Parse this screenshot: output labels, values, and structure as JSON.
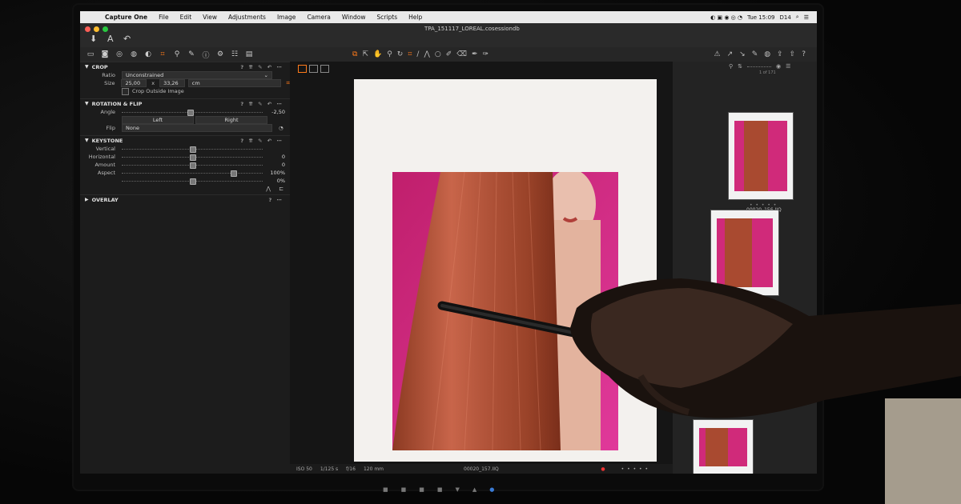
{
  "menubar": {
    "app": "Capture One",
    "items": [
      "File",
      "Edit",
      "View",
      "Adjustments",
      "Image",
      "Camera",
      "Window",
      "Scripts",
      "Help"
    ],
    "clock": "Tue 15:09",
    "user": "D14"
  },
  "document": {
    "title": "TPA_151117_LOREAL.cosessiondb"
  },
  "crop": {
    "header": "CROP",
    "ratio_label": "Ratio",
    "ratio_value": "Unconstrained",
    "size_label": "Size",
    "width": "25,00",
    "x": "x",
    "height": "33,26",
    "unit": "cm",
    "outside_label": "Crop Outside Image"
  },
  "rotation": {
    "header": "ROTATION & FLIP",
    "angle_label": "Angle",
    "angle_value": "-2,50",
    "left_label": "Left",
    "right_label": "Right",
    "flip_label": "Flip",
    "flip_value": "None"
  },
  "keystone": {
    "header": "KEYSTONE",
    "rows": [
      {
        "label": "Vertical",
        "value": "",
        "pos": 0.5
      },
      {
        "label": "Horizontal",
        "value": "0",
        "pos": 0.5
      },
      {
        "label": "Amount",
        "value": "0",
        "pos": 0.5
      },
      {
        "label": "Aspect",
        "value": "100%",
        "pos": 0.8
      },
      {
        "label": "",
        "value": "0%",
        "pos": 0.5
      }
    ]
  },
  "overlay": {
    "header": "OVERLAY"
  },
  "viewer": {
    "iso": "ISO 50",
    "shutter": "1/125 s",
    "aperture": "f/16",
    "focal": "120 mm",
    "filename": "00020_157.IIQ",
    "counter": "1 of 171"
  },
  "browser": {
    "thumbs": [
      {
        "name": ""
      },
      {
        "name": "00020_156.IIQ"
      },
      {
        "name": "00020_157.IIQ"
      },
      {
        "name": ""
      }
    ]
  },
  "colors": {
    "accent": "#ff7a1a",
    "magenta": "#d02a7a",
    "hair": "#a6452a"
  }
}
